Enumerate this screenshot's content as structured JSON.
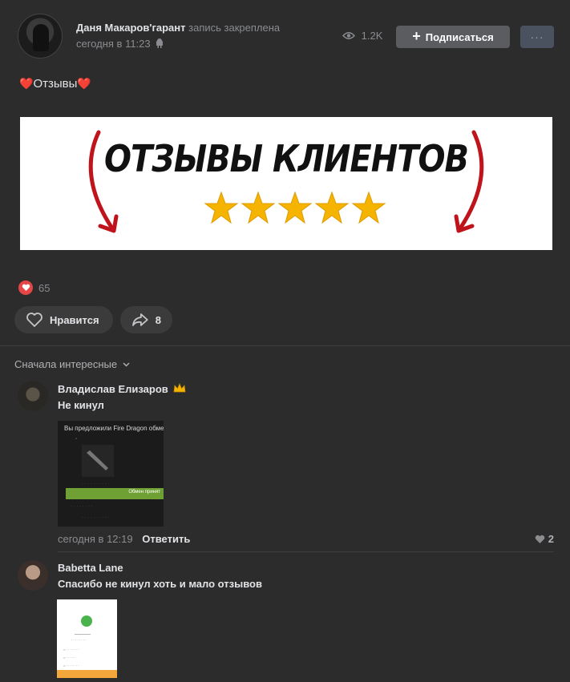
{
  "post": {
    "author": "Даня Макаров'гарант",
    "action": "запись закреплена",
    "time": "сегодня в 11:23",
    "views": "1.2K",
    "subscribe_label": "Подписаться",
    "more_label": "···",
    "text_heart_left": "❤️",
    "text": "Отзывы",
    "text_heart_right": "❤️",
    "banner_title": "ОТЗЫВЫ КЛИЕНТОВ",
    "banner_star_count": 5,
    "likes_count": "65",
    "like_button_label": "Нравится",
    "share_count": "8"
  },
  "comments_sort": "Сначала интересные",
  "comments": [
    {
      "author": "Владислав Елизаров",
      "text": "Не кинул",
      "thumb_header": "Вы предложили Fire Dragon обмен:",
      "thumb_green_text": "Обмен принят",
      "time": "сегодня в 12:19",
      "reply_label": "Ответить",
      "likes": "2"
    },
    {
      "author": "Babetta Lane",
      "text": "Спасибо не кинул хоть и мало отзывов"
    }
  ],
  "colors": {
    "background": "#2c2c2c",
    "like_red": "#e64646",
    "banner_arrow": "#c0141c",
    "star": "#f5b400"
  }
}
